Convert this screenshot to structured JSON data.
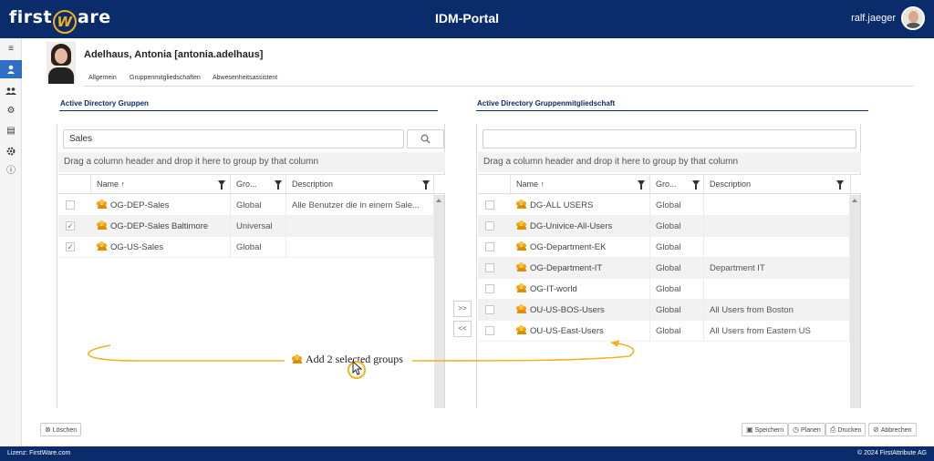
{
  "header": {
    "logo_left": "first",
    "logo_mark": "W",
    "logo_right": "are",
    "title": "IDM-Portal",
    "user": "ralf.jaeger"
  },
  "sidenav": {
    "items": [
      {
        "name": "menu-icon",
        "glyph": "≡"
      },
      {
        "name": "user-icon",
        "glyph": "👤"
      },
      {
        "name": "users-group-icon",
        "glyph": "👥"
      },
      {
        "name": "gears-icon",
        "glyph": "⚙"
      },
      {
        "name": "document-icon",
        "glyph": "▤"
      },
      {
        "name": "settings-icon",
        "glyph": "✿"
      },
      {
        "name": "info-icon",
        "glyph": "ⓘ"
      }
    ]
  },
  "profile": {
    "name": "Adelhaus, Antonia [antonia.adelhaus]",
    "tabs": [
      "Allgemein",
      "Gruppenmitgliedschaften",
      "Abwesenheitsassistent"
    ]
  },
  "left": {
    "title": "Active Directory Gruppen",
    "search_value": "Sales",
    "search_icon": "🔍",
    "group_hint": "Drag a column header and drop it here to group by that column",
    "columns": [
      "Name",
      "Gro...",
      "Description"
    ],
    "sort_mark": "↑",
    "rows": [
      {
        "checked": "",
        "name": "OG-DEP-Sales",
        "scope": "Global",
        "description": "Alle Benutzer die in einem Sale..."
      },
      {
        "checked": "✓",
        "name": "OG-DEP-Sales Baltimore",
        "scope": "Universal",
        "description": ""
      },
      {
        "checked": "✓",
        "name": "OG-US-Sales",
        "scope": "Global",
        "description": ""
      }
    ]
  },
  "right": {
    "title": "Active Directory Gruppenmitgliedschaft",
    "search_value": "",
    "group_hint": "Drag a column header and drop it here to group by that column",
    "columns": [
      "Name",
      "Gro...",
      "Description"
    ],
    "sort_mark": "↑",
    "rows": [
      {
        "checked": "",
        "name": "DG-ALL USERS",
        "scope": "Global",
        "description": ""
      },
      {
        "checked": "",
        "name": "DG-Univice-All-Users",
        "scope": "Global",
        "description": ""
      },
      {
        "checked": "",
        "name": "OG-Department-EK",
        "scope": "Global",
        "description": ""
      },
      {
        "checked": "",
        "name": "OG-Department-IT",
        "scope": "Global",
        "description": "Department IT"
      },
      {
        "checked": "",
        "name": "OG-IT-world",
        "scope": "Global",
        "description": ""
      },
      {
        "checked": "",
        "name": "OU-US-BOS-Users",
        "scope": "Global",
        "description": "All Users from Boston"
      },
      {
        "checked": "",
        "name": "OU-US-East-Users",
        "scope": "Global",
        "description": "All Users from Eastern US"
      }
    ]
  },
  "transfer": {
    "add": ">>",
    "remove": "<<"
  },
  "annotation": {
    "text": "Add 2 selected groups"
  },
  "actions": {
    "delete": "Löschen",
    "save": "Speichern",
    "plan": "Planen",
    "print": "Drucken",
    "cancel": "Abbrechen"
  },
  "footer": {
    "license": "Lizenz: FirstWare.com",
    "copyright": "© 2024 FirstAttribute AG"
  },
  "colors": {
    "brand": "#0a2c6b",
    "accent": "#f3b21a",
    "nav_active": "#2f6ec2"
  }
}
